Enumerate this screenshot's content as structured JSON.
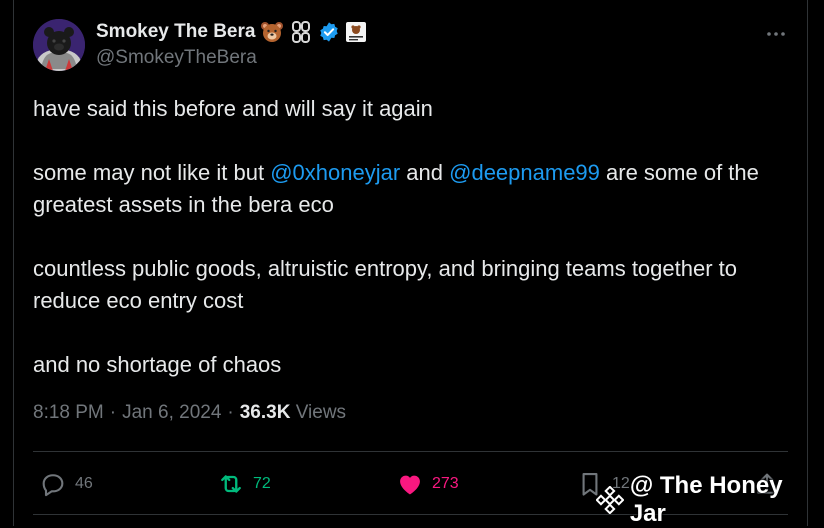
{
  "author": {
    "display_name": "Smokey The Bera",
    "handle": "@SmokeyTheBera",
    "avatar_icon": "bear-hoodie-avatar",
    "badges": [
      "bear-face-icon",
      "chain-icon",
      "verified-badge-icon",
      "flag-icon"
    ]
  },
  "tweet": {
    "line1": "have said this before and will say it again",
    "p2_before": "some may not like it but ",
    "mention1": "@0xhoneyjar",
    "p2_mid": " and ",
    "mention2": "@deepname99",
    "p2_after": " are some of the greatest assets in the bera eco",
    "p3": "countless public goods, altruistic entropy, and bringing teams together to reduce eco entry cost",
    "p4": "and no shortage of chaos"
  },
  "meta": {
    "time": "8:18 PM",
    "sep1": "·",
    "date": "Jan 6, 2024",
    "sep2": "·",
    "views_count": "36.3K",
    "views_label": "Views"
  },
  "actions": {
    "replies": "46",
    "reposts": "72",
    "likes": "273",
    "bookmarks": "12"
  },
  "watermark": {
    "text": "@ The Honey Jar"
  },
  "colors": {
    "background": "#000000",
    "text": "#e7e9ea",
    "muted": "#71767b",
    "mention": "#1d9bf0",
    "repost": "#00ba7c",
    "like": "#f91880",
    "verified": "#1d9bf0"
  }
}
